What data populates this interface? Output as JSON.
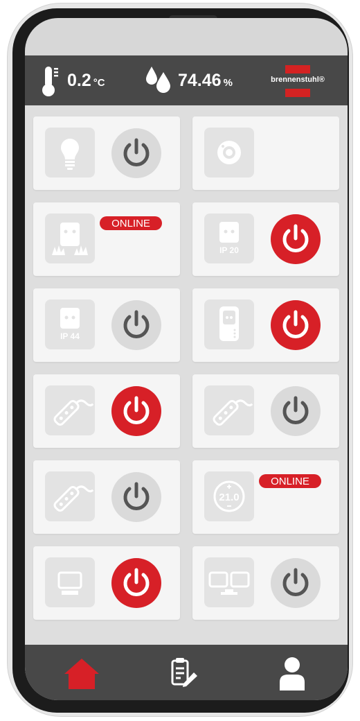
{
  "status": {
    "temperature": {
      "value": "0.2",
      "unit": "°C",
      "icon": "thermometer-icon"
    },
    "humidity": {
      "value": "74.46",
      "unit": "%",
      "icon": "water-drops-icon"
    },
    "brand": "brennenstuhl®"
  },
  "colors": {
    "accent": "#d72027",
    "statusbar": "#484848",
    "off_button": "#dadada"
  },
  "devices": [
    {
      "icon": "light-bulb-icon",
      "power": "off"
    },
    {
      "icon": "smoke-detector-icon",
      "power": null
    },
    {
      "icon": "outdoor-socket-icon",
      "badge": "ONLINE",
      "power": null
    },
    {
      "icon": "socket-ip20-icon",
      "icon_label": "IP 20",
      "power": "on"
    },
    {
      "icon": "socket-ip44-icon",
      "icon_label": "IP 44",
      "power": "off"
    },
    {
      "icon": "plug-adapter-icon",
      "power": "on"
    },
    {
      "icon": "power-strip-icon",
      "power": "on"
    },
    {
      "icon": "power-strip-icon",
      "power": "off"
    },
    {
      "icon": "power-strip-icon",
      "power": "off"
    },
    {
      "icon": "thermostat-icon",
      "icon_label": "21.0",
      "badge": "ONLINE",
      "power": null
    },
    {
      "icon": "monitor-icon",
      "power": "on"
    },
    {
      "icon": "dual-monitor-icon",
      "power": "off"
    }
  ],
  "nav": [
    {
      "icon": "home-icon",
      "active": true
    },
    {
      "icon": "clipboard-edit-icon",
      "active": false
    },
    {
      "icon": "user-icon",
      "active": false
    }
  ]
}
